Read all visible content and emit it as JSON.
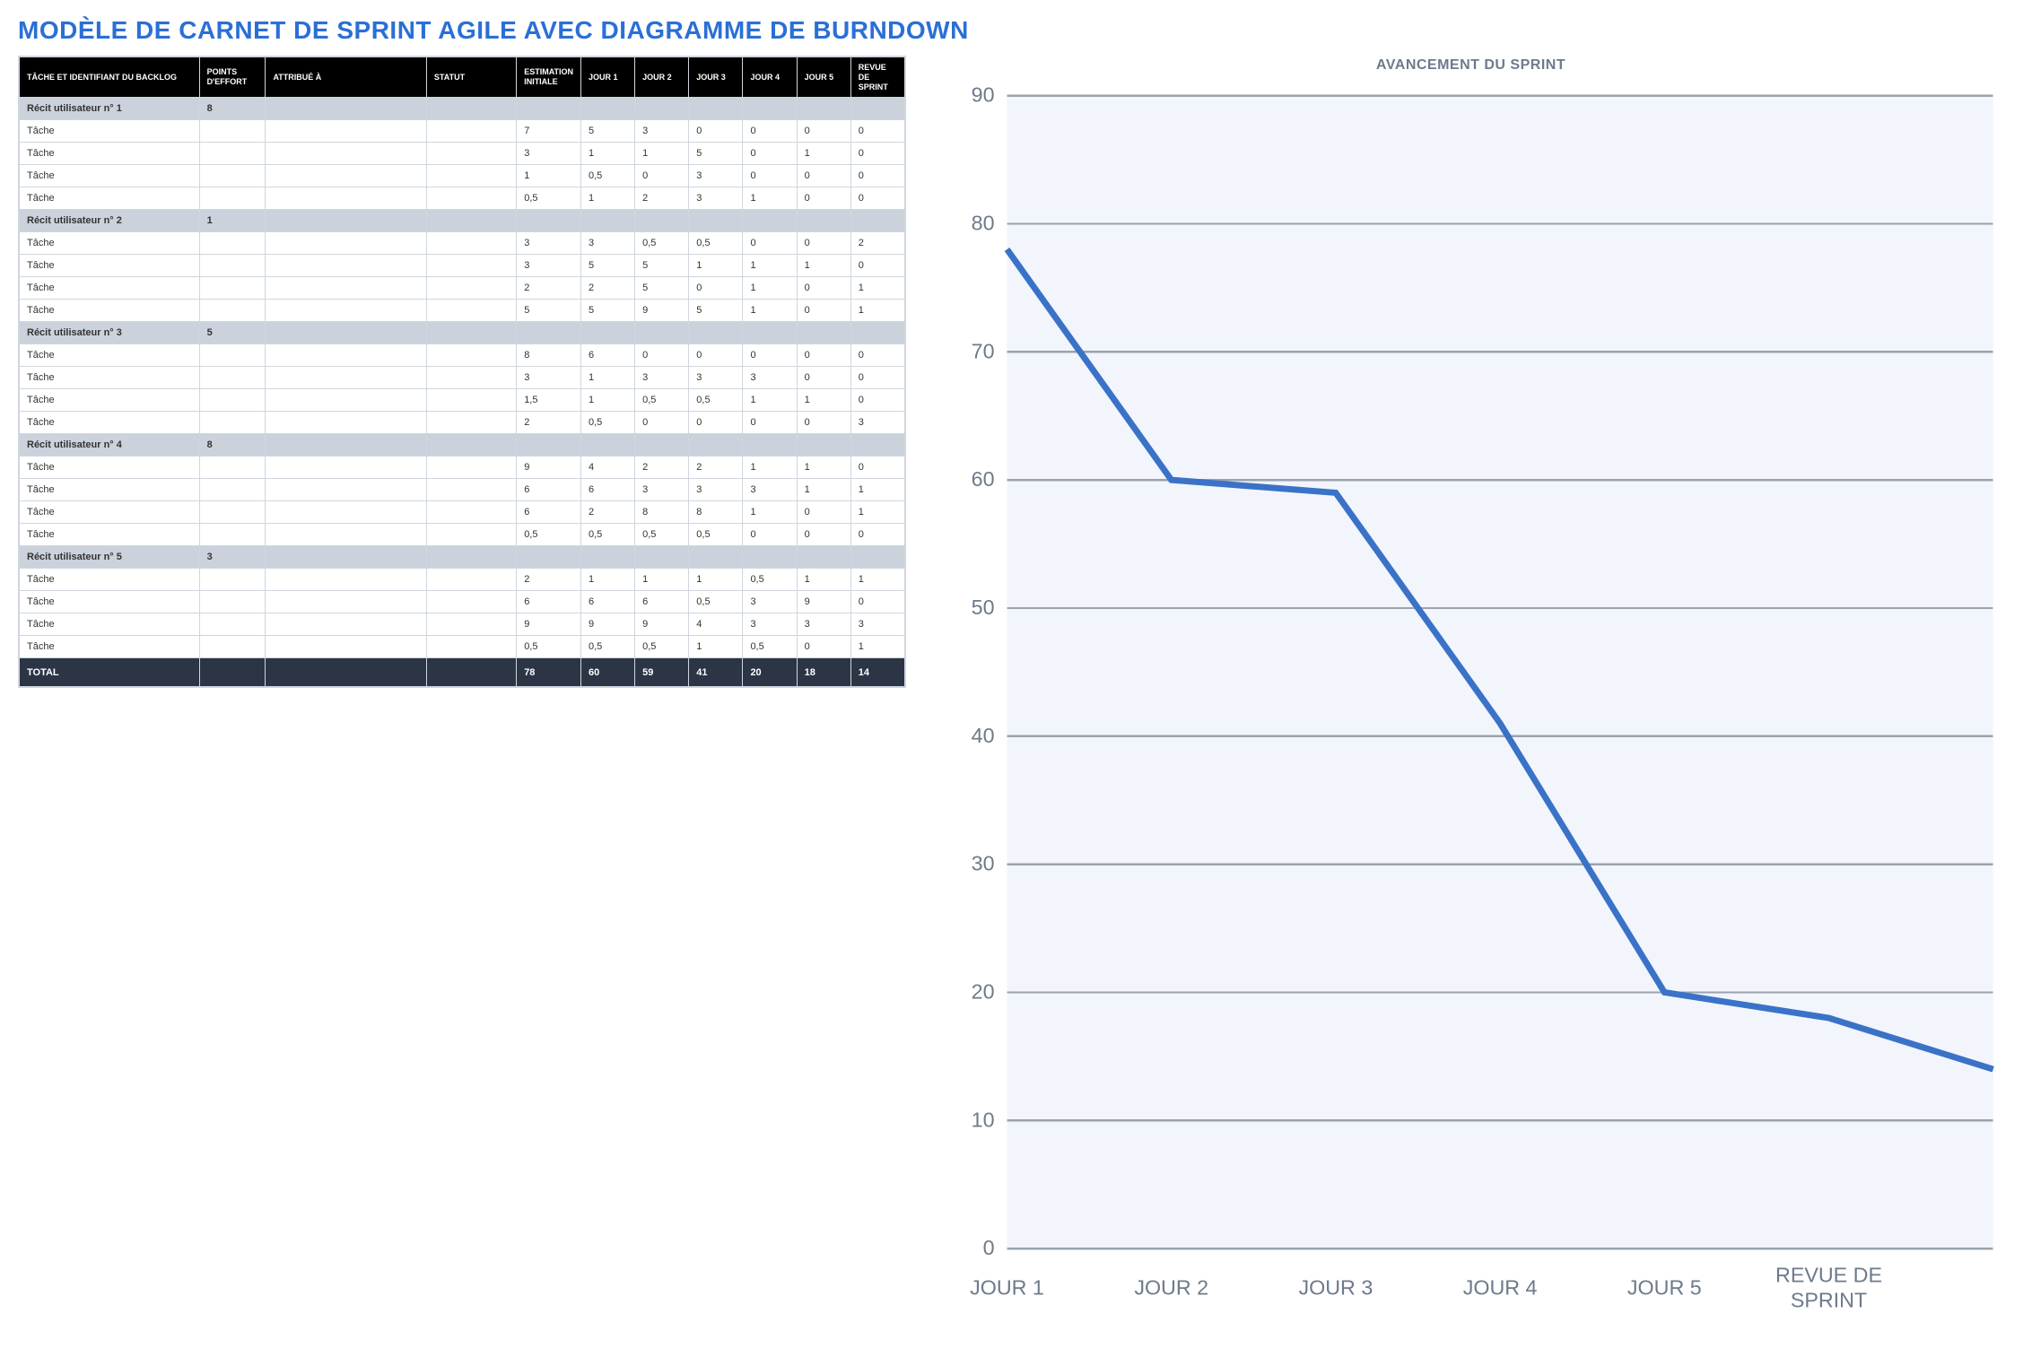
{
  "title": "MODÈLE DE CARNET DE SPRINT AGILE AVEC DIAGRAMME DE BURNDOWN",
  "columns": {
    "task_id": "TÂCHE ET IDENTIFIANT DU BACKLOG",
    "effort": "POINTS D'EFFORT",
    "assigned": "ATTRIBUÉ À",
    "status": "STATUT",
    "estimate": "ESTIMATION INITIALE",
    "day1": "JOUR 1",
    "day2": "JOUR 2",
    "day3": "JOUR 3",
    "day4": "JOUR 4",
    "day5": "JOUR 5",
    "review": "REVUE DE SPRINT"
  },
  "task_label": "Tâche",
  "stories": [
    {
      "name": "Récit utilisateur n° 1",
      "effort": "8",
      "tasks": [
        {
          "estimate": "7",
          "day1": "5",
          "day2": "3",
          "day3": "0",
          "day4": "0",
          "day5": "0",
          "review": "0"
        },
        {
          "estimate": "3",
          "day1": "1",
          "day2": "1",
          "day3": "5",
          "day4": "0",
          "day5": "1",
          "review": "0"
        },
        {
          "estimate": "1",
          "day1": "0,5",
          "day2": "0",
          "day3": "3",
          "day4": "0",
          "day5": "0",
          "review": "0"
        },
        {
          "estimate": "0,5",
          "day1": "1",
          "day2": "2",
          "day3": "3",
          "day4": "1",
          "day5": "0",
          "review": "0"
        }
      ]
    },
    {
      "name": "Récit utilisateur n° 2",
      "effort": "1",
      "tasks": [
        {
          "estimate": "3",
          "day1": "3",
          "day2": "0,5",
          "day3": "0,5",
          "day4": "0",
          "day5": "0",
          "review": "2"
        },
        {
          "estimate": "3",
          "day1": "5",
          "day2": "5",
          "day3": "1",
          "day4": "1",
          "day5": "1",
          "review": "0"
        },
        {
          "estimate": "2",
          "day1": "2",
          "day2": "5",
          "day3": "0",
          "day4": "1",
          "day5": "0",
          "review": "1"
        },
        {
          "estimate": "5",
          "day1": "5",
          "day2": "9",
          "day3": "5",
          "day4": "1",
          "day5": "0",
          "review": "1"
        }
      ]
    },
    {
      "name": "Récit utilisateur n° 3",
      "effort": "5",
      "tasks": [
        {
          "estimate": "8",
          "day1": "6",
          "day2": "0",
          "day3": "0",
          "day4": "0",
          "day5": "0",
          "review": "0"
        },
        {
          "estimate": "3",
          "day1": "1",
          "day2": "3",
          "day3": "3",
          "day4": "3",
          "day5": "0",
          "review": "0"
        },
        {
          "estimate": "1,5",
          "day1": "1",
          "day2": "0,5",
          "day3": "0,5",
          "day4": "1",
          "day5": "1",
          "review": "0"
        },
        {
          "estimate": "2",
          "day1": "0,5",
          "day2": "0",
          "day3": "0",
          "day4": "0",
          "day5": "0",
          "review": "3"
        }
      ]
    },
    {
      "name": "Récit utilisateur n° 4",
      "effort": "8",
      "tasks": [
        {
          "estimate": "9",
          "day1": "4",
          "day2": "2",
          "day3": "2",
          "day4": "1",
          "day5": "1",
          "review": "0"
        },
        {
          "estimate": "6",
          "day1": "6",
          "day2": "3",
          "day3": "3",
          "day4": "3",
          "day5": "1",
          "review": "1"
        },
        {
          "estimate": "6",
          "day1": "2",
          "day2": "8",
          "day3": "8",
          "day4": "1",
          "day5": "0",
          "review": "1"
        },
        {
          "estimate": "0,5",
          "day1": "0,5",
          "day2": "0,5",
          "day3": "0,5",
          "day4": "0",
          "day5": "0",
          "review": "0"
        }
      ]
    },
    {
      "name": "Récit utilisateur n° 5",
      "effort": "3",
      "tasks": [
        {
          "estimate": "2",
          "day1": "1",
          "day2": "1",
          "day3": "1",
          "day4": "0,5",
          "day5": "1",
          "review": "1"
        },
        {
          "estimate": "6",
          "day1": "6",
          "day2": "6",
          "day3": "0,5",
          "day4": "3",
          "day5": "9",
          "review": "0"
        },
        {
          "estimate": "9",
          "day1": "9",
          "day2": "9",
          "day3": "4",
          "day4": "3",
          "day5": "3",
          "review": "3"
        },
        {
          "estimate": "0,5",
          "day1": "0,5",
          "day2": "0,5",
          "day3": "1",
          "day4": "0,5",
          "day5": "0",
          "review": "1"
        }
      ]
    }
  ],
  "totals": {
    "label": "TOTAL",
    "estimate": "78",
    "day1": "60",
    "day2": "59",
    "day3": "41",
    "day4": "20",
    "day5": "18",
    "review": "14"
  },
  "chart_data": {
    "type": "line",
    "title": "AVANCEMENT DU SPRINT",
    "categories": [
      "JOUR 1",
      "JOUR 2",
      "JOUR 3",
      "JOUR 4",
      "JOUR 5",
      "REVUE DE SPRINT",
      ""
    ],
    "values": [
      78,
      60,
      59,
      41,
      20,
      18,
      14
    ],
    "ylabel": "",
    "xlabel": "",
    "ylim": [
      0,
      90
    ],
    "yticks": [
      0,
      10,
      20,
      30,
      40,
      50,
      60,
      70,
      80,
      90
    ]
  }
}
